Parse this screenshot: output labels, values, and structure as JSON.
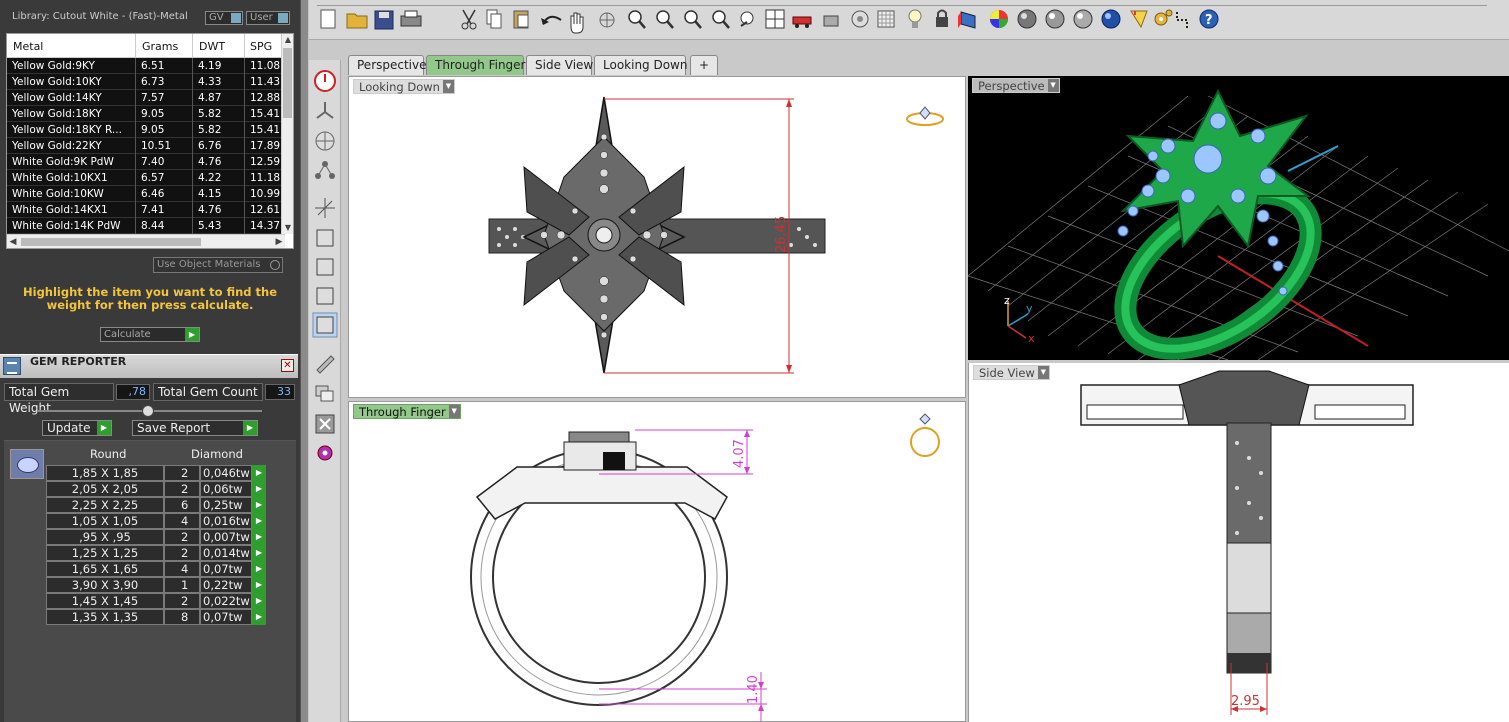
{
  "library": {
    "title": "Library: Cutout White - (Fast)-Metal",
    "toggle_gv": "GV",
    "toggle_user": "User",
    "columns": [
      "Metal",
      "Grams",
      "DWT",
      "SPG"
    ],
    "rows": [
      [
        "Yellow Gold:9KY",
        "6.51",
        "4.19",
        "11.08"
      ],
      [
        "Yellow Gold:10KY",
        "6.73",
        "4.33",
        "11.43"
      ],
      [
        "Yellow Gold:14KY",
        "7.57",
        "4.87",
        "12.88"
      ],
      [
        "Yellow Gold:18KY",
        "9.05",
        "5.82",
        "15.41"
      ],
      [
        "Yellow Gold:18KY R...",
        "9.05",
        "5.82",
        "15.41"
      ],
      [
        "Yellow Gold:22KY",
        "10.51",
        "6.76",
        "17.89"
      ],
      [
        "White Gold:9K PdW",
        "7.40",
        "4.76",
        "12.59"
      ],
      [
        "White Gold:10KX1",
        "6.57",
        "4.22",
        "11.18"
      ],
      [
        "White Gold:10KW",
        "6.46",
        "4.15",
        "10.99"
      ],
      [
        "White Gold:14KX1",
        "7.41",
        "4.76",
        "12.61"
      ],
      [
        "White Gold:14K PdW",
        "8.44",
        "5.43",
        "14.37"
      ]
    ],
    "use_object_materials": "Use Object Materials",
    "instruction": "Highlight the item you want to find the weight for then press calculate.",
    "calculate": "Calculate"
  },
  "gem_reporter": {
    "title": "GEM REPORTER",
    "total_weight_label": "Total Gem Weight",
    "total_weight_value": ",78",
    "total_count_label": "Total Gem Count",
    "total_count_value": "33",
    "update": "Update",
    "save_report": "Save Report",
    "col_shape": "Round",
    "col_type": "Diamond",
    "rows": [
      [
        "1,85 X 1,85",
        "2",
        "0,046tw"
      ],
      [
        "2,05 X 2,05",
        "2",
        "0,06tw"
      ],
      [
        "2,25 X 2,25",
        "6",
        "0,25tw"
      ],
      [
        "1,05 X 1,05",
        "4",
        "0,016tw"
      ],
      [
        ",95 X ,95",
        "2",
        "0,007tw"
      ],
      [
        "1,25 X 1,25",
        "2",
        "0,014tw"
      ],
      [
        "1,65 X 1,65",
        "4",
        "0,07tw"
      ],
      [
        "3,90 X 3,90",
        "1",
        "0,22tw"
      ],
      [
        "1,45 X 1,45",
        "2",
        "0,022tw"
      ],
      [
        "1,35 X 1,35",
        "8",
        "0,07tw"
      ]
    ]
  },
  "tabs": [
    "Perspective",
    "Through Finger",
    "Side View",
    "Looking Down",
    "+"
  ],
  "active_tab": "Through Finger",
  "viewports": {
    "looking_down": {
      "label": "Looking Down",
      "dimension": "26.45"
    },
    "through_finger": {
      "label": "Through Finger",
      "dimension_top": "4.07",
      "dimension_bottom": "1.40"
    },
    "perspective": {
      "label": "Perspective",
      "axis_z": "z",
      "axis_y": "y",
      "axis_x": "x"
    },
    "side_view": {
      "label": "Side View",
      "dimension": "2.95"
    }
  },
  "colors": {
    "accent_green": "#92c98a",
    "dim_red": "#d03030",
    "dim_magenta": "#d040d0",
    "gem_blue": "#9cc6ff",
    "render_green": "#1ea84a",
    "warning_yellow": "#f3c53b"
  },
  "icons": [
    "new-file-icon",
    "open-folder-icon",
    "save-icon",
    "print-icon",
    "cut-icon",
    "copy-icon",
    "paste-icon",
    "undo-icon",
    "pan-hand-icon",
    "rotate-icon",
    "zoom-icon",
    "zoom-window-icon",
    "zoom-extents-icon",
    "zoom-selected-icon",
    "rotate-view-icon",
    "four-viewports-icon",
    "car-icon",
    "lock-layer-icon",
    "target-icon",
    "bulb-icon",
    "lock-icon",
    "book-icon",
    "color-wheel-icon",
    "sphere-icon",
    "shaded-sphere-icon",
    "render-sphere-icon",
    "blue-sphere-icon",
    "funnel-icon",
    "gears-icon",
    "curve-icon",
    "help-icon"
  ]
}
